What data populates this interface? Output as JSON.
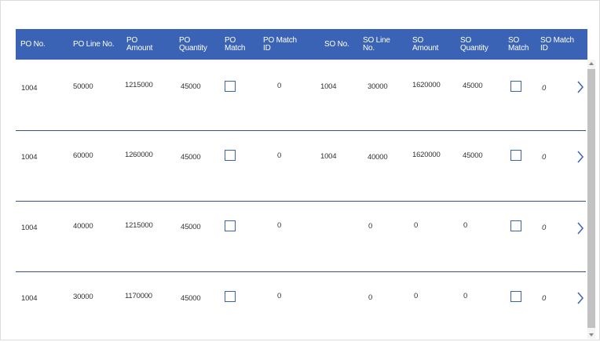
{
  "columns": [
    {
      "key": "po_no",
      "label": "PO No."
    },
    {
      "key": "po_line_no",
      "label": "PO Line No."
    },
    {
      "key": "po_amount",
      "label": "PO\nAmount"
    },
    {
      "key": "po_quantity",
      "label": "PO\nQuantity"
    },
    {
      "key": "po_match",
      "label": "PO\nMatch"
    },
    {
      "key": "po_match_id",
      "label": "PO Match\nID"
    },
    {
      "key": "so_no",
      "label": "SO No."
    },
    {
      "key": "so_line_no",
      "label": "SO Line\nNo."
    },
    {
      "key": "so_amount",
      "label": "SO\nAmount"
    },
    {
      "key": "so_quantity",
      "label": "SO\nQuantity"
    },
    {
      "key": "so_match",
      "label": "SO\nMatch"
    },
    {
      "key": "so_match_id",
      "label": "SO Match\nID"
    }
  ],
  "rows": [
    {
      "po_no": "1004",
      "po_line_no": "50000",
      "po_amount": "1215000",
      "po_quantity": "45000",
      "po_match": false,
      "po_match_id": "0",
      "so_no": "1004",
      "so_line_no": "30000",
      "so_amount": "1620000",
      "so_quantity": "45000",
      "so_match": false,
      "so_match_id": "0"
    },
    {
      "po_no": "1004",
      "po_line_no": "60000",
      "po_amount": "1260000",
      "po_quantity": "45000",
      "po_match": false,
      "po_match_id": "0",
      "so_no": "1004",
      "so_line_no": "40000",
      "so_amount": "1620000",
      "so_quantity": "45000",
      "so_match": false,
      "so_match_id": "0"
    },
    {
      "po_no": "1004",
      "po_line_no": "40000",
      "po_amount": "1215000",
      "po_quantity": "45000",
      "po_match": false,
      "po_match_id": "0",
      "so_no": "",
      "so_line_no": "0",
      "so_amount": "0",
      "so_quantity": "0",
      "so_match": false,
      "so_match_id": "0"
    },
    {
      "po_no": "1004",
      "po_line_no": "30000",
      "po_amount": "1170000",
      "po_quantity": "45000",
      "po_match": false,
      "po_match_id": "0",
      "so_no": "",
      "so_line_no": "0",
      "so_amount": "0",
      "so_quantity": "0",
      "so_match": false,
      "so_match_id": "0"
    }
  ],
  "icons": {
    "row_action": "chevron-right-icon",
    "scroll_up": "scroll-up-arrow",
    "scroll_down": "scroll-down-arrow"
  },
  "colors": {
    "header_bg": "#3a63b5",
    "header_text": "#ffffff",
    "accent": "#3a63b5",
    "divider": "#3a4f80"
  }
}
